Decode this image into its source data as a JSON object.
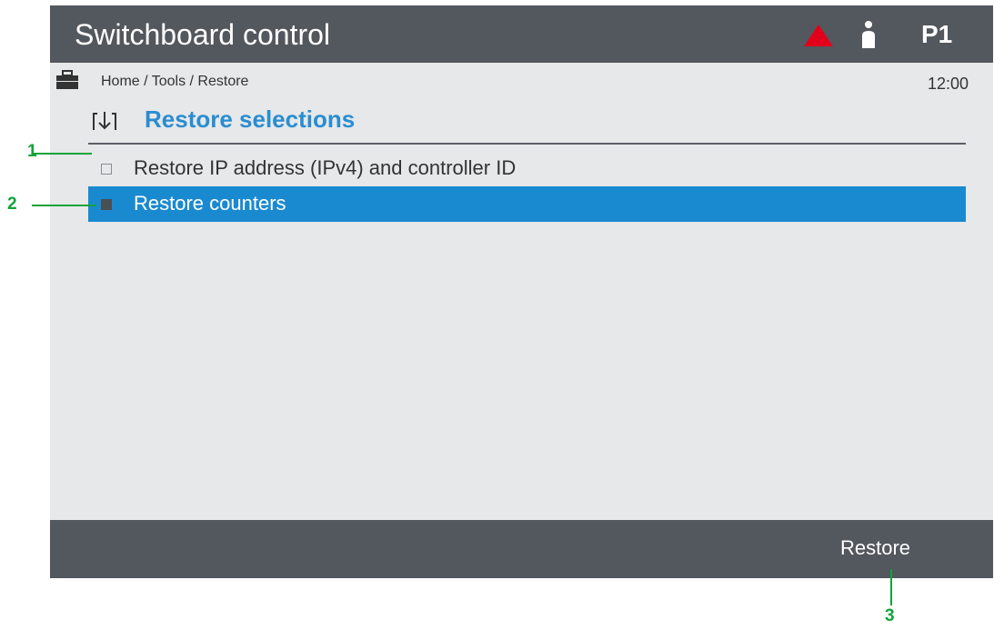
{
  "header": {
    "title": "Switchboard control",
    "profile": "P1",
    "alarm_icon": "warning-triangle-icon",
    "user_icon": "user-icon"
  },
  "breadcrumb": {
    "icon": "toolbox-icon",
    "path": "Home / Tools / Restore",
    "time": "12:00"
  },
  "section": {
    "icon": "restore-download-icon",
    "title": "Restore selections"
  },
  "items": [
    {
      "label": "Restore IP address (IPv4) and controller ID",
      "checked": false,
      "selected": false
    },
    {
      "label": "Restore counters",
      "checked": true,
      "selected": true
    }
  ],
  "footer": {
    "softkey_label": "Restore"
  },
  "callouts": {
    "one": "1",
    "two": "2",
    "three": "3"
  },
  "colors": {
    "bar": "#53575e",
    "background": "#e6e8e9",
    "accent": "#2a8dd1",
    "selection": "#1a8ad0",
    "alarm": "#e3001b",
    "callout": "#11a33a"
  }
}
